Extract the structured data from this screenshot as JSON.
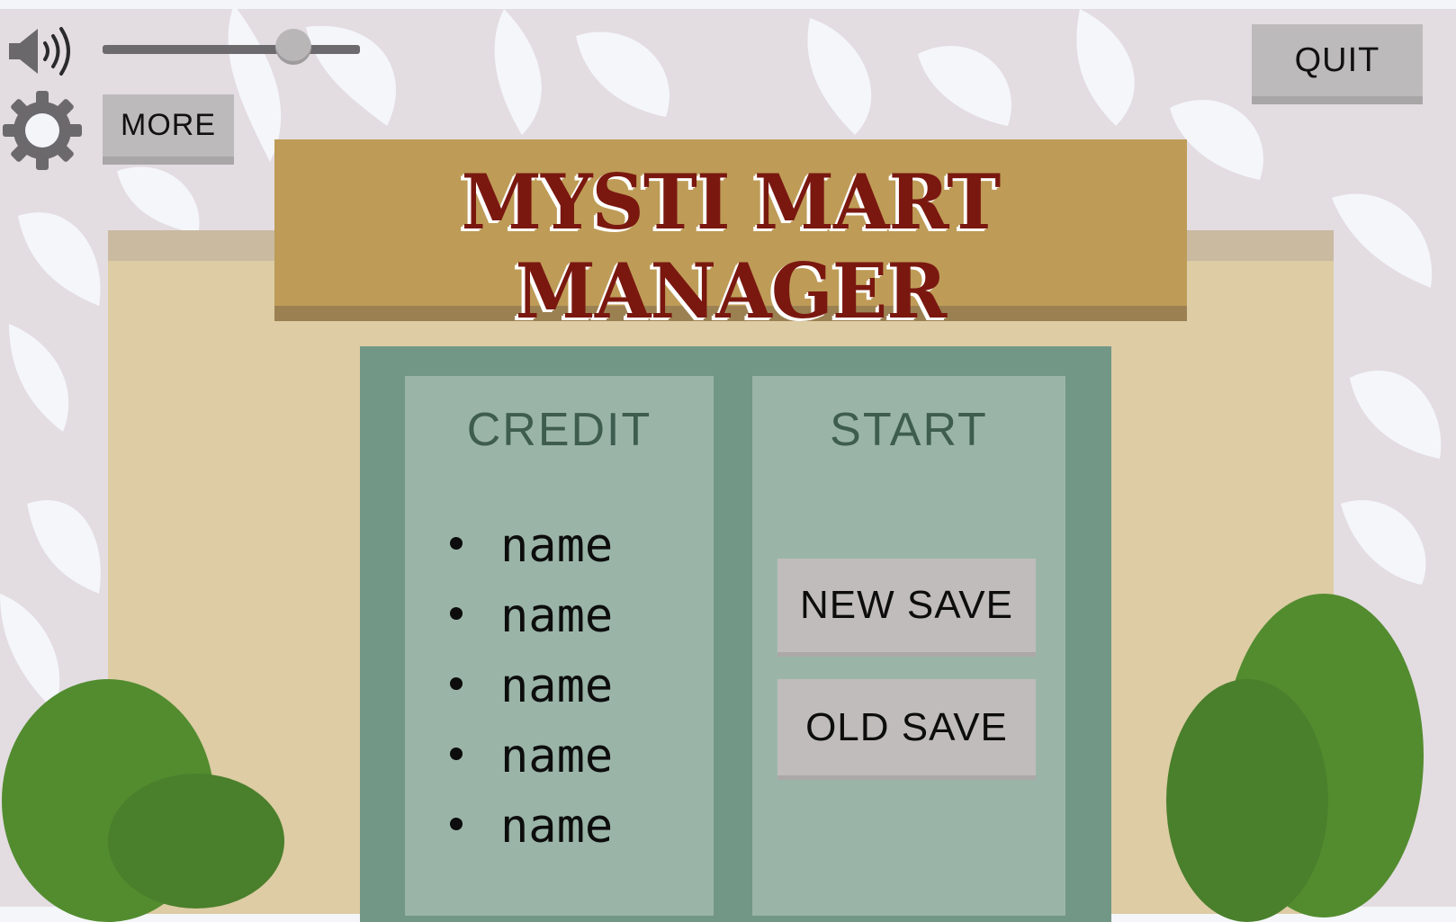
{
  "game": {
    "title": "MYSTI MART MANAGER"
  },
  "top_bar": {
    "volume_icon": "speaker-icon",
    "volume_level": 0.74,
    "settings_icon": "gear-icon",
    "more_label": "MORE",
    "quit_label": "QUIT"
  },
  "credit": {
    "heading": "CREDIT",
    "names": [
      "name",
      "name",
      "name",
      "name",
      "name"
    ]
  },
  "start": {
    "heading": "START",
    "new_save_label": "NEW SAVE",
    "old_save_label": "OLD SAVE"
  },
  "colors": {
    "sign": "#be9c57",
    "title": "#7a1810",
    "door": "#729787",
    "panel": "#9ab5a8",
    "wall": "#ddcca4",
    "bush": "#528c2f"
  }
}
